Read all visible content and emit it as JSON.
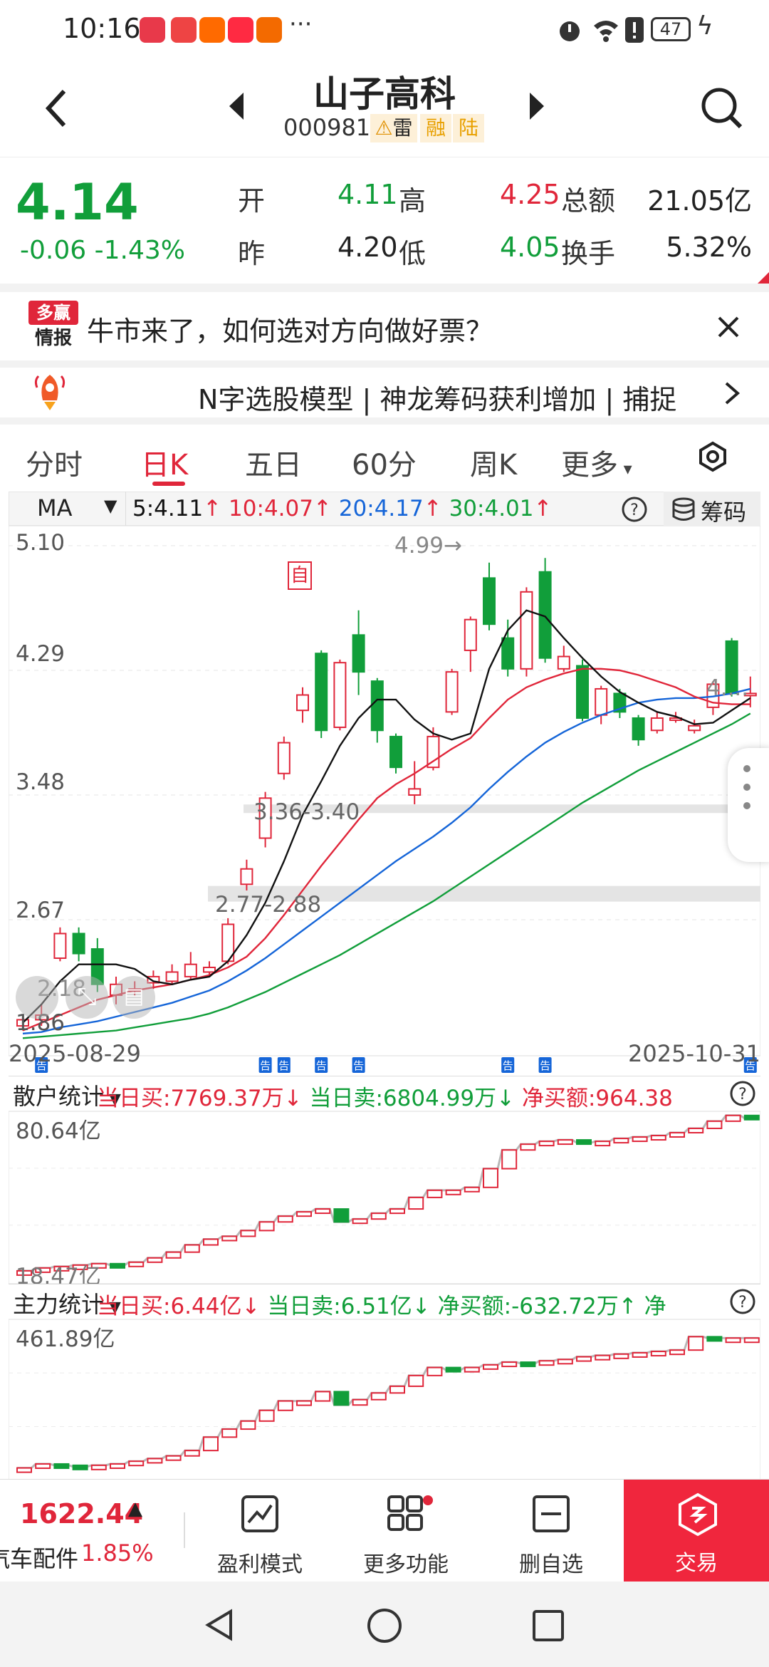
{
  "status_bar": {
    "time": "10:16",
    "battery": "47"
  },
  "header": {
    "title": "山子高科",
    "code": "000981",
    "tags": [
      "雷",
      "融",
      "陆"
    ]
  },
  "quote": {
    "price": "4.14",
    "change": "-0.06",
    "change_pct": "-1.43%",
    "open_label": "开",
    "open": "4.11",
    "high_label": "高",
    "high": "4.25",
    "amount_label": "总额",
    "amount": "21.05亿",
    "prev_label": "昨",
    "prev": "4.20",
    "low_label": "低",
    "low": "4.05",
    "turnover_label": "换手",
    "turnover": "5.32%"
  },
  "banner1": {
    "logo_top": "多赢",
    "logo_bottom": "情报",
    "text": "牛市来了，如何选对方向做好票？"
  },
  "banner2": {
    "text": "N字选股模型 | 神龙筹码获利增加 | 捕捉"
  },
  "tabs": [
    "分时",
    "日K",
    "五日",
    "60分",
    "周K",
    "更多"
  ],
  "active_tab": "日K",
  "ma_bar": {
    "select": "MA",
    "ma5": "5:4.11",
    "ma10": "10:4.07",
    "ma20": "20:4.17",
    "ma30": "30:4.01",
    "chips": "筹码"
  },
  "kline": {
    "y_labels": [
      "5.10",
      "4.29",
      "3.48",
      "2.67",
      "1.86"
    ],
    "start_date": "2025-08-29",
    "end_date": "2025-10-31",
    "max_label": "4.99→",
    "zone1": "3.36-3.40",
    "zone2": "2.77-2.88",
    "self_tag": "自",
    "partial_left": "2.18",
    "partial_right": "4....",
    "notice_tag": "告"
  },
  "retail": {
    "label": "散户统计",
    "buy": "当日买:7769.37万↓",
    "sell": "当日卖:6804.99万↓",
    "net": "净买额:964.38",
    "max": "80.64亿",
    "min": "18.47亿"
  },
  "main": {
    "label": "主力统计",
    "buy": "当日买:6.44亿↓",
    "sell": "当日卖:6.51亿↓",
    "net": "净买额:-632.72万↑",
    "net2": "净",
    "max": "461.89亿"
  },
  "bottom": {
    "index_value": "1622.44",
    "index_arrow": "▲",
    "index_name": "汽车配件",
    "index_pct": "1.85%",
    "btn_profit": "盈利模式",
    "btn_more": "更多功能",
    "btn_remove": "删自选",
    "btn_trade": "交易"
  },
  "colors": {
    "up": "#e0263a",
    "down": "#119e3a",
    "ma5": "#111111",
    "ma10": "#e0263a",
    "ma20": "#1565d8",
    "ma30": "#119e3a"
  },
  "chart_data": {
    "type": "candlestick",
    "ylim": [
      1.86,
      5.1
    ],
    "candles": [
      {
        "o": 1.98,
        "c": 2.02,
        "h": 2.05,
        "l": 1.95
      },
      {
        "o": 2.02,
        "c": 2.05,
        "h": 2.12,
        "l": 1.98
      },
      {
        "o": 2.42,
        "c": 2.58,
        "h": 2.62,
        "l": 2.4
      },
      {
        "o": 2.58,
        "c": 2.45,
        "h": 2.62,
        "l": 2.4
      },
      {
        "o": 2.48,
        "c": 2.25,
        "h": 2.55,
        "l": 2.2
      },
      {
        "o": 2.18,
        "c": 2.25,
        "h": 2.3,
        "l": 2.12
      },
      {
        "o": 2.22,
        "c": 2.22,
        "h": 2.27,
        "l": 2.17
      },
      {
        "o": 2.26,
        "c": 2.3,
        "h": 2.34,
        "l": 2.22
      },
      {
        "o": 2.27,
        "c": 2.33,
        "h": 2.38,
        "l": 2.25
      },
      {
        "o": 2.3,
        "c": 2.38,
        "h": 2.46,
        "l": 2.28
      },
      {
        "o": 2.33,
        "c": 2.36,
        "h": 2.4,
        "l": 2.3
      },
      {
        "o": 2.4,
        "c": 2.64,
        "h": 2.68,
        "l": 2.38
      },
      {
        "o": 2.9,
        "c": 3.0,
        "h": 3.06,
        "l": 2.86
      },
      {
        "o": 3.2,
        "c": 3.46,
        "h": 3.5,
        "l": 3.14
      },
      {
        "o": 3.62,
        "c": 3.82,
        "h": 3.86,
        "l": 3.58
      },
      {
        "o": 4.03,
        "c": 4.13,
        "h": 4.18,
        "l": 3.95
      },
      {
        "o": 4.4,
        "c": 3.9,
        "h": 4.42,
        "l": 3.85
      },
      {
        "o": 3.92,
        "c": 4.34,
        "h": 4.36,
        "l": 3.9
      },
      {
        "o": 4.52,
        "c": 4.28,
        "h": 4.68,
        "l": 4.13
      },
      {
        "o": 4.22,
        "c": 3.9,
        "h": 4.24,
        "l": 3.82
      },
      {
        "o": 3.86,
        "c": 3.66,
        "h": 3.88,
        "l": 3.62
      },
      {
        "o": 3.48,
        "c": 3.52,
        "h": 3.7,
        "l": 3.42
      },
      {
        "o": 3.66,
        "c": 3.86,
        "h": 3.92,
        "l": 3.64
      },
      {
        "o": 4.02,
        "c": 4.28,
        "h": 4.3,
        "l": 4.0
      },
      {
        "o": 4.42,
        "c": 4.62,
        "h": 4.64,
        "l": 4.28
      },
      {
        "o": 4.89,
        "c": 4.59,
        "h": 4.99,
        "l": 4.55
      },
      {
        "o": 4.5,
        "c": 4.3,
        "h": 4.62,
        "l": 4.25
      },
      {
        "o": 4.3,
        "c": 4.8,
        "h": 4.83,
        "l": 4.25
      },
      {
        "o": 4.93,
        "c": 4.37,
        "h": 5.02,
        "l": 4.34
      },
      {
        "o": 4.3,
        "c": 4.38,
        "h": 4.45,
        "l": 4.28
      },
      {
        "o": 4.32,
        "c": 3.98,
        "h": 4.36,
        "l": 3.96
      },
      {
        "o": 4.0,
        "c": 4.17,
        "h": 4.19,
        "l": 3.94
      },
      {
        "o": 4.14,
        "c": 4.02,
        "h": 4.17,
        "l": 3.98
      },
      {
        "o": 3.98,
        "c": 3.84,
        "h": 4.0,
        "l": 3.8
      },
      {
        "o": 3.9,
        "c": 3.98,
        "h": 4.02,
        "l": 3.88
      },
      {
        "o": 3.98,
        "c": 3.98,
        "h": 4.02,
        "l": 3.95
      },
      {
        "o": 3.9,
        "c": 3.93,
        "h": 3.97,
        "l": 3.88
      },
      {
        "o": 4.05,
        "c": 4.2,
        "h": 4.22,
        "l": 4.0
      },
      {
        "o": 4.48,
        "c": 4.14,
        "h": 4.5,
        "l": 4.12
      },
      {
        "o": 4.14,
        "c": 4.14,
        "h": 4.25,
        "l": 4.05
      }
    ],
    "ma5": [
      2.0,
      2.12,
      2.27,
      2.38,
      2.38,
      2.38,
      2.35,
      2.27,
      2.25,
      2.28,
      2.3,
      2.4,
      2.57,
      2.78,
      3.05,
      3.35,
      3.57,
      3.8,
      3.98,
      4.1,
      4.1,
      3.97,
      3.88,
      3.84,
      3.88,
      4.3,
      4.55,
      4.68,
      4.64,
      4.5,
      4.37,
      4.25,
      4.15,
      4.08,
      4.02,
      3.99,
      3.94,
      3.95,
      4.03,
      4.11
    ],
    "ma10": [
      1.95,
      2.0,
      2.05,
      2.1,
      2.15,
      2.18,
      2.21,
      2.23,
      2.25,
      2.28,
      2.31,
      2.36,
      2.43,
      2.55,
      2.7,
      2.86,
      3.02,
      3.17,
      3.32,
      3.46,
      3.55,
      3.62,
      3.7,
      3.78,
      3.85,
      3.98,
      4.1,
      4.18,
      4.23,
      4.27,
      4.3,
      4.3,
      4.29,
      4.26,
      4.22,
      4.18,
      4.12,
      4.08,
      4.07,
      4.07
    ],
    "ma20": [
      1.93,
      1.94,
      1.97,
      1.99,
      2.01,
      2.04,
      2.07,
      2.1,
      2.13,
      2.17,
      2.21,
      2.27,
      2.34,
      2.42,
      2.51,
      2.6,
      2.69,
      2.78,
      2.87,
      2.96,
      3.05,
      3.13,
      3.21,
      3.3,
      3.4,
      3.52,
      3.63,
      3.73,
      3.82,
      3.89,
      3.95,
      4.0,
      4.04,
      4.08,
      4.1,
      4.11,
      4.11,
      4.12,
      4.14,
      4.17
    ],
    "ma30": [
      1.9,
      1.91,
      1.92,
      1.93,
      1.94,
      1.95,
      1.97,
      1.99,
      2.01,
      2.03,
      2.06,
      2.1,
      2.15,
      2.2,
      2.26,
      2.32,
      2.38,
      2.44,
      2.51,
      2.58,
      2.65,
      2.72,
      2.79,
      2.87,
      2.95,
      3.03,
      3.11,
      3.19,
      3.27,
      3.35,
      3.43,
      3.5,
      3.57,
      3.64,
      3.7,
      3.76,
      3.82,
      3.88,
      3.94,
      4.01
    ],
    "retail_series": [
      0.04,
      0.06,
      0.07,
      0.08,
      0.09,
      0.08,
      0.1,
      0.13,
      0.17,
      0.22,
      0.26,
      0.28,
      0.32,
      0.38,
      0.42,
      0.45,
      0.47,
      0.38,
      0.4,
      0.44,
      0.47,
      0.55,
      0.6,
      0.6,
      0.62,
      0.75,
      0.88,
      0.92,
      0.94,
      0.95,
      0.93,
      0.94,
      0.96,
      0.97,
      0.98,
      1.0,
      1.03,
      1.08,
      1.12,
      1.1
    ],
    "main_series": [
      0.05,
      0.08,
      0.07,
      0.06,
      0.07,
      0.08,
      0.1,
      0.12,
      0.14,
      0.18,
      0.28,
      0.34,
      0.4,
      0.48,
      0.55,
      0.55,
      0.62,
      0.52,
      0.56,
      0.61,
      0.66,
      0.74,
      0.8,
      0.78,
      0.8,
      0.82,
      0.84,
      0.83,
      0.85,
      0.86,
      0.88,
      0.89,
      0.9,
      0.91,
      0.92,
      0.93,
      1.03,
      1.02,
      1.02,
      1.02
    ]
  }
}
